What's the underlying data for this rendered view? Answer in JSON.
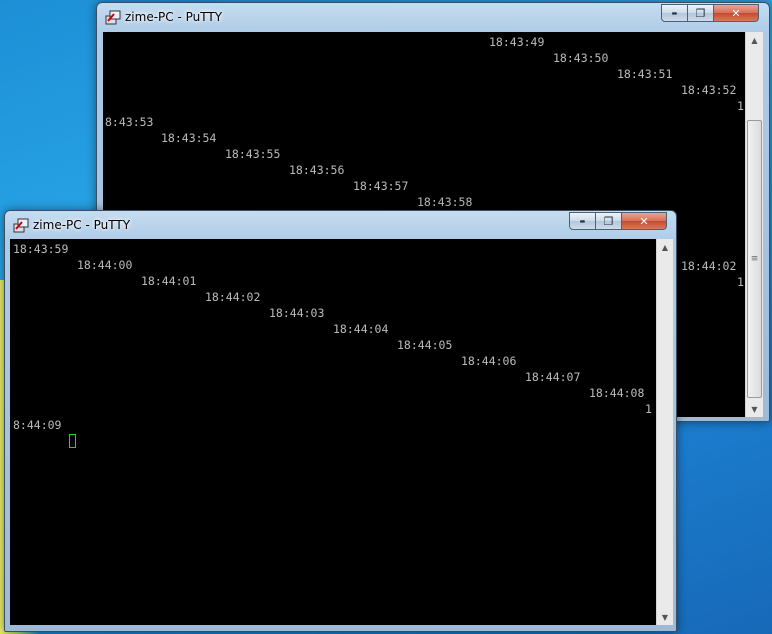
{
  "back_window": {
    "title": "zime-PC - PuTTY",
    "lines": [
      "18:43:49",
      "18:43:50",
      "18:43:51",
      "18:43:52",
      "1",
      "8:43:53",
      "18:43:54",
      "18:43:55",
      "18:43:56",
      "18:43:57",
      "18:43:58",
      "18:44:02",
      "1"
    ]
  },
  "front_window": {
    "title": "zime-PC - PuTTY",
    "lines": [
      "18:43:59",
      "18:44:00",
      "18:44:01",
      "18:44:02",
      "18:44:03",
      "18:44:04",
      "18:44:05",
      "18:44:06",
      "18:44:07",
      "18:44:08",
      "1",
      "8:44:09"
    ]
  },
  "caption_buttons": {
    "minimize": "▬",
    "maximize": "❐",
    "close": "✕"
  },
  "colors": {
    "terminal_bg": "#000000",
    "terminal_fg": "#bbbbbb",
    "cursor": "#2bd02b"
  }
}
